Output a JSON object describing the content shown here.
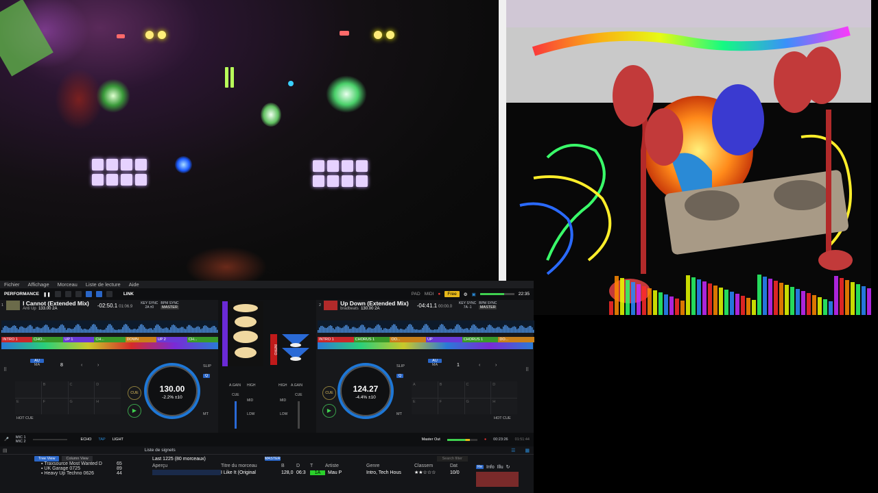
{
  "menu": [
    "Fichier",
    "Affichage",
    "Morceau",
    "Liste de lecture",
    "Aide"
  ],
  "toolbar": {
    "mode": "PERFORMANCE",
    "link": "LINK",
    "pad": "PAD",
    "midi": "MIDI",
    "free": "Free",
    "clock": "22:35"
  },
  "deck1": {
    "num": "1",
    "title": "I Cannot  (Extended Mix)",
    "artist": "Anti Up",
    "bpm_key": "133.00  2A",
    "remain": "-02:50.1",
    "elapsed": "01:06.9",
    "keysync": "KEY SYNC",
    "bpmsync": "BPM SYNC",
    "key": "2A",
    "keyoff": "±0",
    "master": "MASTER",
    "jog_bpm": "130.00",
    "jog_pct": "-2.2%  ±10",
    "beat": "8",
    "cue": "CUE",
    "slip": "SLIP",
    "q": "Q",
    "mt": "MT",
    "au": "AU",
    "ma": "MA",
    "hotcue": "HOT CUE",
    "hc_time": "00:00",
    "cues": [
      {
        "label": "INTRO 1",
        "color": "#c8282a"
      },
      {
        "label": "CHO...",
        "color": "#3a9a2a"
      },
      {
        "label": "UP 1",
        "color": "#6a3ad6"
      },
      {
        "label": "CH...",
        "color": "#3a9a2a"
      },
      {
        "label": "DOWN",
        "color": "#c9801a"
      },
      {
        "label": "UP 2",
        "color": "#6a3ad6"
      },
      {
        "label": "CH...",
        "color": "#3a9a2a"
      }
    ],
    "hc": [
      "",
      "B",
      "C",
      "D",
      "E",
      "F",
      "G",
      "H"
    ]
  },
  "deck2": {
    "num": "2",
    "title": "Up Down  (Extended Mix)",
    "artist": "bradbeats",
    "bpm_key": "130.00  2A",
    "remain": "-04:41.1",
    "elapsed": "00:00.0",
    "keysync": "KEY SYNC",
    "bpmsync": "BPM SYNC",
    "key": "7A",
    "keyoff": "-1",
    "master": "MASTER",
    "jog_bpm": "124.27",
    "jog_pct": "-4.4%  ±10",
    "beat": "1",
    "cue": "CUE",
    "slip": "SLIP",
    "q": "Q",
    "mt": "MT",
    "au": "AU",
    "ma": "MA",
    "hotcue": "HOT CUE",
    "cues": [
      {
        "label": "INTRO 1",
        "color": "#c8282a"
      },
      {
        "label": "CHORUS 1",
        "color": "#3a9a2a"
      },
      {
        "label": "OO...",
        "color": "#c9801a"
      },
      {
        "label": "UP",
        "color": "#6a3ad6"
      },
      {
        "label": "CHORUS 1",
        "color": "#3a9a2a"
      },
      {
        "label": "DO...",
        "color": "#c9801a"
      }
    ],
    "hc": [
      "A",
      "B",
      "C",
      "D",
      "E",
      "F",
      "G",
      "H"
    ]
  },
  "mixer": {
    "again": "A.GAIN",
    "high": "HIGH",
    "cue": "CUE",
    "mid": "MID",
    "low": "LOW",
    "intro": "INTRO"
  },
  "fx": {
    "mic1": "MIC 1",
    "mic2": "MIC 2",
    "echo": "ECHO",
    "light": "LIGHT",
    "tap": "TAP",
    "master_out": "Master Out",
    "time1": "00:23:26",
    "time2": "01:51:44"
  },
  "browser": {
    "signets": "Liste de signets",
    "tree": "Tree View",
    "column": "Column View",
    "playlist": "Last 1225 (80 morceaux)",
    "master": "MASTER",
    "search": "Search filter",
    "folders": [
      {
        "name": "Traxsource Most Wanted D",
        "n": "65"
      },
      {
        "name": "UK Garage 0725",
        "n": "89"
      },
      {
        "name": "Heavy Up Techno 0626",
        "n": "44"
      }
    ],
    "cols": [
      "Aperçu",
      "Titre du morceau",
      "B",
      "D",
      "T",
      "Artiste",
      "Genre",
      "Classem",
      "Dat"
    ],
    "row": {
      "title": "I Like It (Original",
      "b": "128,0",
      "d": "06:3",
      "key": "1A",
      "artist": "Mau P",
      "genre": "Intro, Tech Hous",
      "rating": "★★☆☆☆",
      "date": "10/0"
    },
    "tabs": [
      "Re",
      "Info",
      "Illu"
    ]
  }
}
